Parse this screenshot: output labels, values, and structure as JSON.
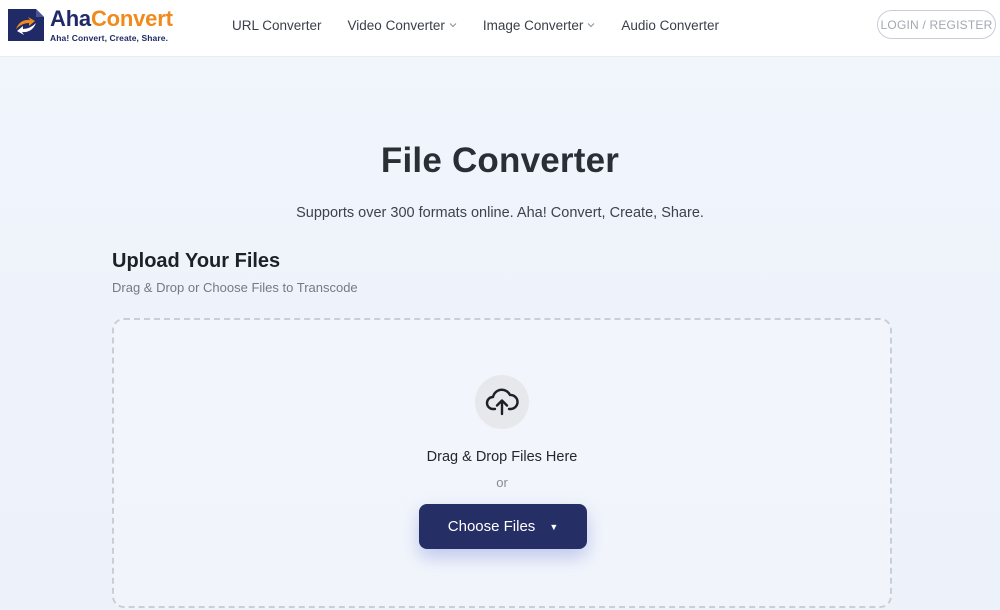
{
  "header": {
    "logo": {
      "name_part1": "Aha",
      "name_part2": "Convert",
      "tagline": "Aha! Convert, Create, Share."
    },
    "nav": [
      {
        "label": "URL Converter",
        "has_dropdown": false
      },
      {
        "label": "Video Converter",
        "has_dropdown": true
      },
      {
        "label": "Image Converter",
        "has_dropdown": true
      },
      {
        "label": "Audio Converter",
        "has_dropdown": false
      }
    ],
    "login_label": "LOGIN / REGISTER"
  },
  "main": {
    "title": "File Converter",
    "subtitle": "Supports over 300 formats online. Aha! Convert, Create, Share.",
    "upload": {
      "heading": "Upload Your Files",
      "subheading": "Drag & Drop or Choose Files to Transcode",
      "drop_text": "Drag & Drop Files Here",
      "or_text": "or",
      "choose_label": "Choose Files",
      "choose_caret": "▼"
    }
  },
  "colors": {
    "brand_navy": "#262e66",
    "brand_orange": "#f08a1c",
    "page_bg": "#eef3fb"
  },
  "icons": [
    "logo-mark-icon",
    "chevron-down-icon",
    "cloud-upload-icon",
    "caret-down-icon"
  ]
}
